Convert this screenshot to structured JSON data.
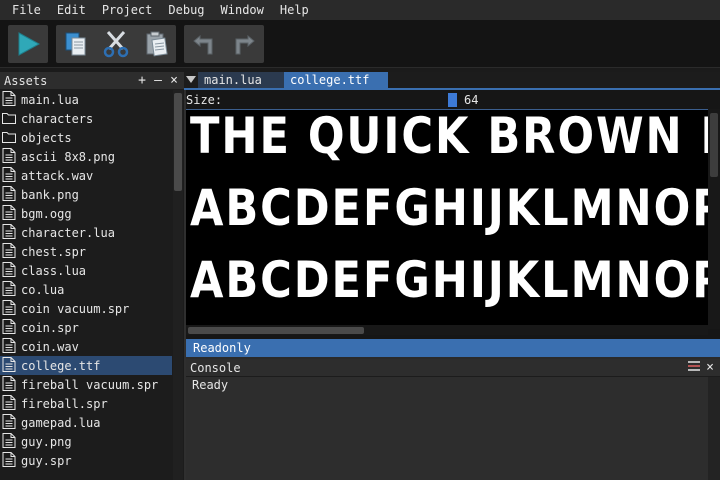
{
  "menu": [
    "File",
    "Edit",
    "Project",
    "Debug",
    "Window",
    "Help"
  ],
  "toolbar": {
    "run": "play-icon",
    "copy": "copy-icon",
    "cut": "scissors-icon",
    "paste": "paste-icon",
    "undo": "undo-icon",
    "redo": "redo-icon",
    "accent": "#2fa8b8"
  },
  "assets": {
    "title": "Assets",
    "header_icons": [
      "+",
      "—",
      "×"
    ],
    "items": [
      {
        "label": "main.lua",
        "icon": "file-icon"
      },
      {
        "label": "characters",
        "icon": "folder-icon"
      },
      {
        "label": "objects",
        "icon": "folder-icon"
      },
      {
        "label": "ascii 8x8.png",
        "icon": "file-icon"
      },
      {
        "label": "attack.wav",
        "icon": "file-icon"
      },
      {
        "label": "bank.png",
        "icon": "file-icon"
      },
      {
        "label": "bgm.ogg",
        "icon": "file-icon"
      },
      {
        "label": "character.lua",
        "icon": "file-icon"
      },
      {
        "label": "chest.spr",
        "icon": "file-icon"
      },
      {
        "label": "class.lua",
        "icon": "file-icon"
      },
      {
        "label": "co.lua",
        "icon": "file-icon"
      },
      {
        "label": "coin vacuum.spr",
        "icon": "file-icon"
      },
      {
        "label": "coin.spr",
        "icon": "file-icon"
      },
      {
        "label": "coin.wav",
        "icon": "file-icon"
      },
      {
        "label": "college.ttf",
        "icon": "file-icon",
        "selected": true
      },
      {
        "label": "fireball vacuum.spr",
        "icon": "file-icon"
      },
      {
        "label": "fireball.spr",
        "icon": "file-icon"
      },
      {
        "label": "gamepad.lua",
        "icon": "file-icon"
      },
      {
        "label": "guy.png",
        "icon": "file-icon"
      },
      {
        "label": "guy.spr",
        "icon": "file-icon"
      }
    ]
  },
  "editor": {
    "tabs": [
      {
        "label": "main.lua",
        "active": false
      },
      {
        "label": "college.ttf",
        "active": true
      }
    ],
    "size_label": "Size:",
    "size_value": "64",
    "preview_lines": [
      "THE QUICK BROWN FOX",
      "ABCDEFGHIJKLMNOPQRSTUVWXYZ",
      "ABCDEFGHIJKLMNOPQRSTUVWXYZ"
    ],
    "status": "Readonly"
  },
  "console": {
    "title": "Console",
    "header_icons": [
      "menu-icon",
      "close-icon"
    ],
    "text": "Ready"
  }
}
